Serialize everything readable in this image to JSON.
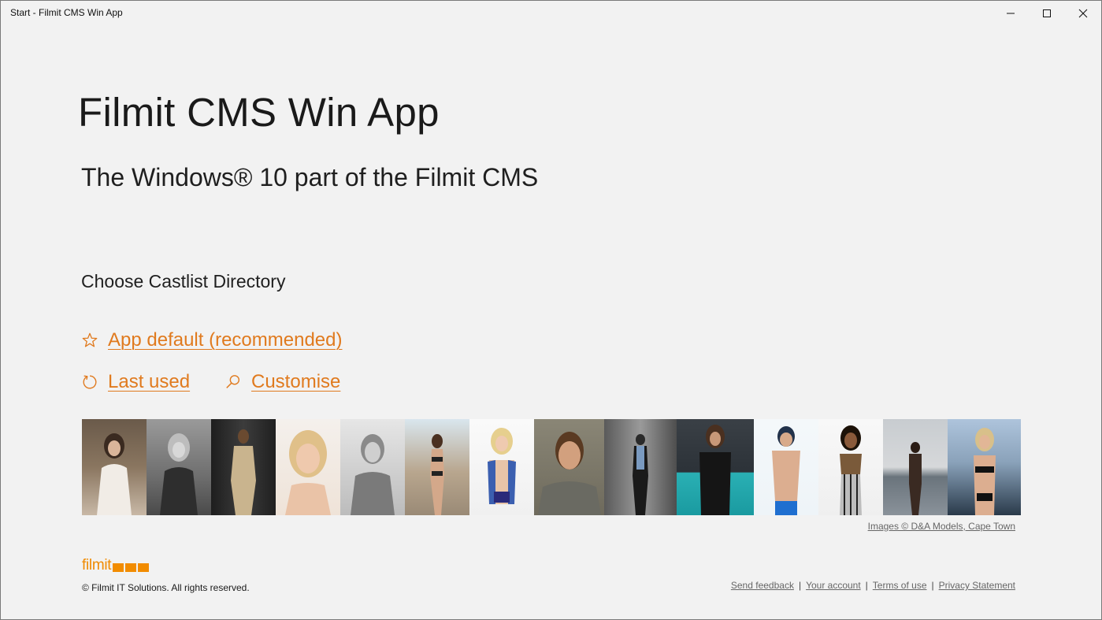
{
  "window": {
    "title": "Start - Filmit CMS Win App",
    "controls": [
      "minimize-icon",
      "maximize-icon",
      "close-icon"
    ]
  },
  "main": {
    "app_title": "Filmit CMS Win App",
    "subtitle": "The Windows® 10 part of the Filmit CMS",
    "section_heading": "Choose Castlist Directory",
    "options": {
      "app_default": {
        "label": "App default (recommended)",
        "icon": "star-icon"
      },
      "last_used": {
        "label": "Last used",
        "icon": "refresh-icon"
      },
      "customise": {
        "label": "Customise",
        "icon": "search-icon"
      }
    },
    "image_credit": "Images © D&A Models, Cape Town"
  },
  "footer": {
    "logo_text": "filmit",
    "copyright": "© Filmit IT Solutions. All rights reserved.",
    "links": {
      "send_feedback": "Send feedback",
      "your_account": "Your account",
      "terms": "Terms of use",
      "privacy": "Privacy Statement"
    }
  },
  "colors": {
    "accent": "#e07a1e",
    "logo_orange": "#f28c00",
    "background": "#f2f2f2"
  }
}
